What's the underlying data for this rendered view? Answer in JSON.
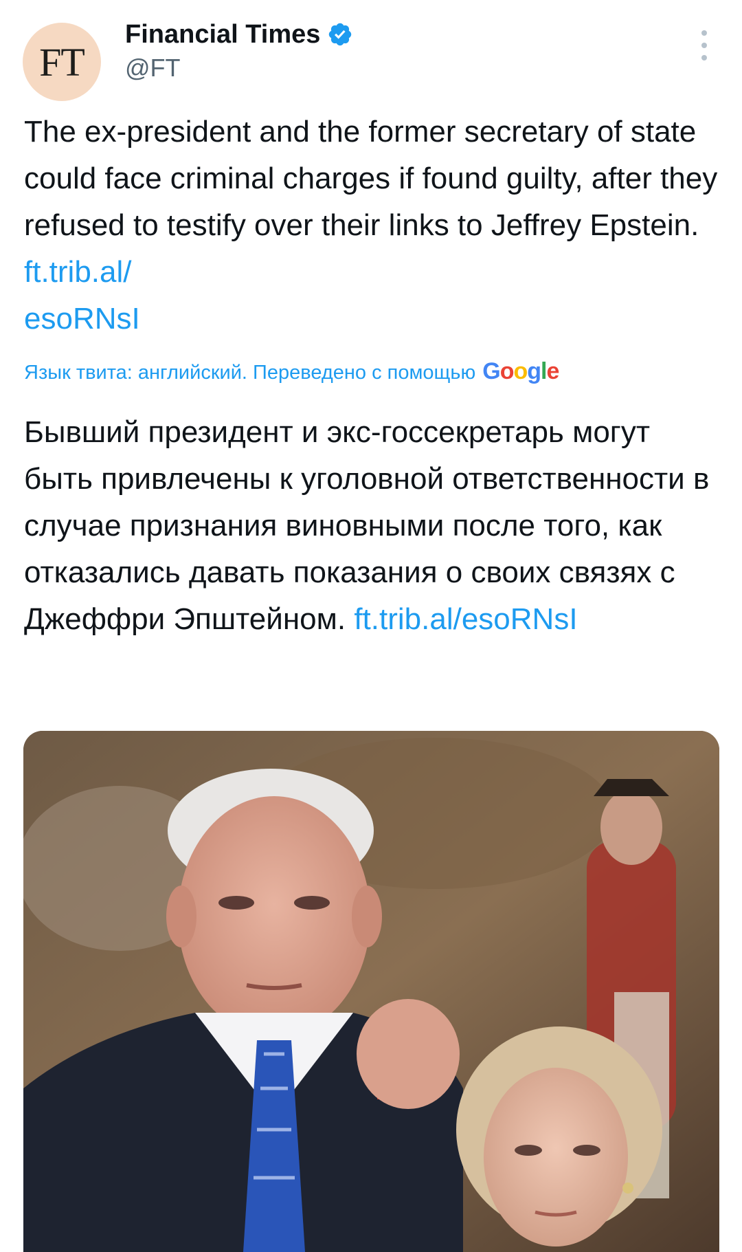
{
  "account": {
    "avatar_text": "FT",
    "display_name": "Financial Times",
    "handle": "@FT",
    "verified": true
  },
  "tweet": {
    "text": "The ex-president and the former secretary of state could face criminal charges if found guilty, after they refused to testify over their links to Jeffrey Epstein.",
    "link_line1": "ft.trib.al/",
    "link_line2": "esoRNsI"
  },
  "translation": {
    "label": "Язык твита: английский. Переведено с помощью",
    "provider": "Google",
    "text": "Бывший президент и экс-госсекретарь могут быть привлечены к уголовной ответственности в случае признания виновными после того, как отказались давать показания о своих связях с Джеффри Эпштейном.",
    "link": "ft.trib.al/esoRNsI"
  },
  "colors": {
    "link": "#1d9bf0",
    "avatar_bg": "#f6d9c2",
    "verified": "#1d9bf0",
    "text": "#0f1419",
    "secondary": "#536471"
  },
  "icons": {
    "verified": "verified-badge-icon",
    "more": "more-options-icon"
  }
}
